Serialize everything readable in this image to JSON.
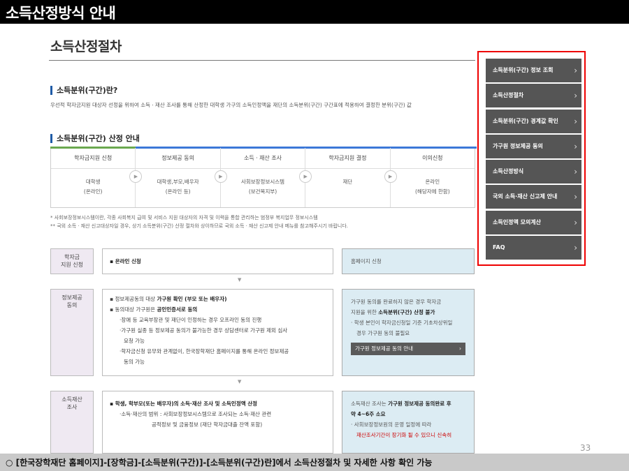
{
  "banner": {
    "title": "소득산정방식 안내"
  },
  "page": {
    "heading": "소득산정절차"
  },
  "section1": {
    "title": "소득분위(구간)란?",
    "desc": "우선적 학자금지원 대상자 선정을 위하여 소득ㆍ재산 조사를 통해 산정한 대학생 가구의 소득인정액을 재단의 소득분위(구간) 구간표에 적용하여 결정한 분위(구간) 값"
  },
  "section2": {
    "title": "소득분위(구간) 산정 안내",
    "steps": [
      {
        "head": "학자금지원 신청",
        "line1": "대학생",
        "line2": "(온라인)"
      },
      {
        "head": "정보제공 동의",
        "line1": "대학생,부모,배우자",
        "line2": "(온라인 등)"
      },
      {
        "head": "소득ㆍ재산 조사",
        "line1": "사회보장정보시스템",
        "line2": "(보건복지부)"
      },
      {
        "head": "학자금지원 결정",
        "line1": "재단",
        "line2": ""
      },
      {
        "head": "이의신청",
        "line1": "온라인",
        "line2": "(해당자에 한함)"
      }
    ],
    "arrow_glyph": "▶",
    "notes": [
      "* 사회보장정보시스템이란, 각종 사회복지 급여 및 서비스 지원 대상자의 자격 및 이력을 통합 관리하는 범정부 복지업무 정보시스템",
      "** 국외 소득ㆍ재산 신고대상자일 경우, 상기 소득분위(구간) 산정 절차와 상이하므로 국외 소득ㆍ재산 신고제 안내 메뉴를 참고해주시기 바랍니다."
    ]
  },
  "rows": {
    "apply": {
      "label1": "학자금",
      "label2": "지원 신청",
      "main": "▪ 온라인 신청",
      "side": "홈페이지 신청"
    },
    "consent": {
      "label1": "정보제공",
      "label2": "동의",
      "l1_pre": "▪ 정보제공동의 대상 ",
      "l1_bold": "가구원 확인 (부모 또는 배우자)",
      "l2_pre": "▪ 동의대상 가구원은 ",
      "l2_bold": "공인인증서로 동의",
      "l3": "·장애 등 교육부장관 및 재단이 인정하는 경우 오프라인 동의 진행",
      "l4": "·가구원 실종 등 정보제공 동의가 불가능한 경우 상담센터로 가구원 제외 심사",
      "l5": "요청 가능",
      "l6": "·학자금신청 유무와 관계없이, 한국장학재단 홈페이지를 통해 온라인 정보제공",
      "l7": "동의 가능",
      "s1": "가구원 동의를 완료하지 않은 경우 학자금",
      "s2_pre": "지원을 위한 ",
      "s2_bold": "소득분위(구간) 산정 불가",
      "s3": "· 학생 본인이 학자금신청일 기준 기초차상위일",
      "s4": "경우 가구원 동의 불필요",
      "button": "가구원 정보제공 동의 안내",
      "button_chev": "›"
    },
    "survey": {
      "label1": "소득재산",
      "label2": "조사",
      "l1": "▪ 학생, 학부모(또는 배우자)의 소득·재산 조사 및 소득인정액 산정",
      "l2": "·소득·재산의 범위 : 사회보장정보시스템으로 조사되는 소득·재산 관련",
      "l3": "공적정보 및 금융정보 (재단 학자금대출 잔액 포함)",
      "s1_pre": "소득재산 조사는 ",
      "s1_bold": "가구원 정보제공 동의완료 후",
      "s2": "약 4~6주 소요",
      "s3": "· 사회보장정보원의 운영 일정에 따라",
      "s4": "재산조사기간이 장기화 될 수 있으니 신속히"
    },
    "down_glyph": "▼"
  },
  "side_menu": {
    "items": [
      "소득분위(구간) 정보 조회",
      "소득산정절차",
      "소득분위(구간) 경계값 확인",
      "가구원 정보제공 동의",
      "소득산정방식",
      "국외 소득·재산 신고제 안내",
      "소득인정액 모의계산",
      "FAQ"
    ],
    "chevron": "›",
    "highlight_color": "#e00000"
  },
  "footer": {
    "page_number": "33",
    "caption": "○ [한국장학재단 홈페이지]-[장학금]-[소득분위(구간)]-[소득분위(구간)란]에서 소득산정절차 및 자세한 사항 확인 가능"
  }
}
